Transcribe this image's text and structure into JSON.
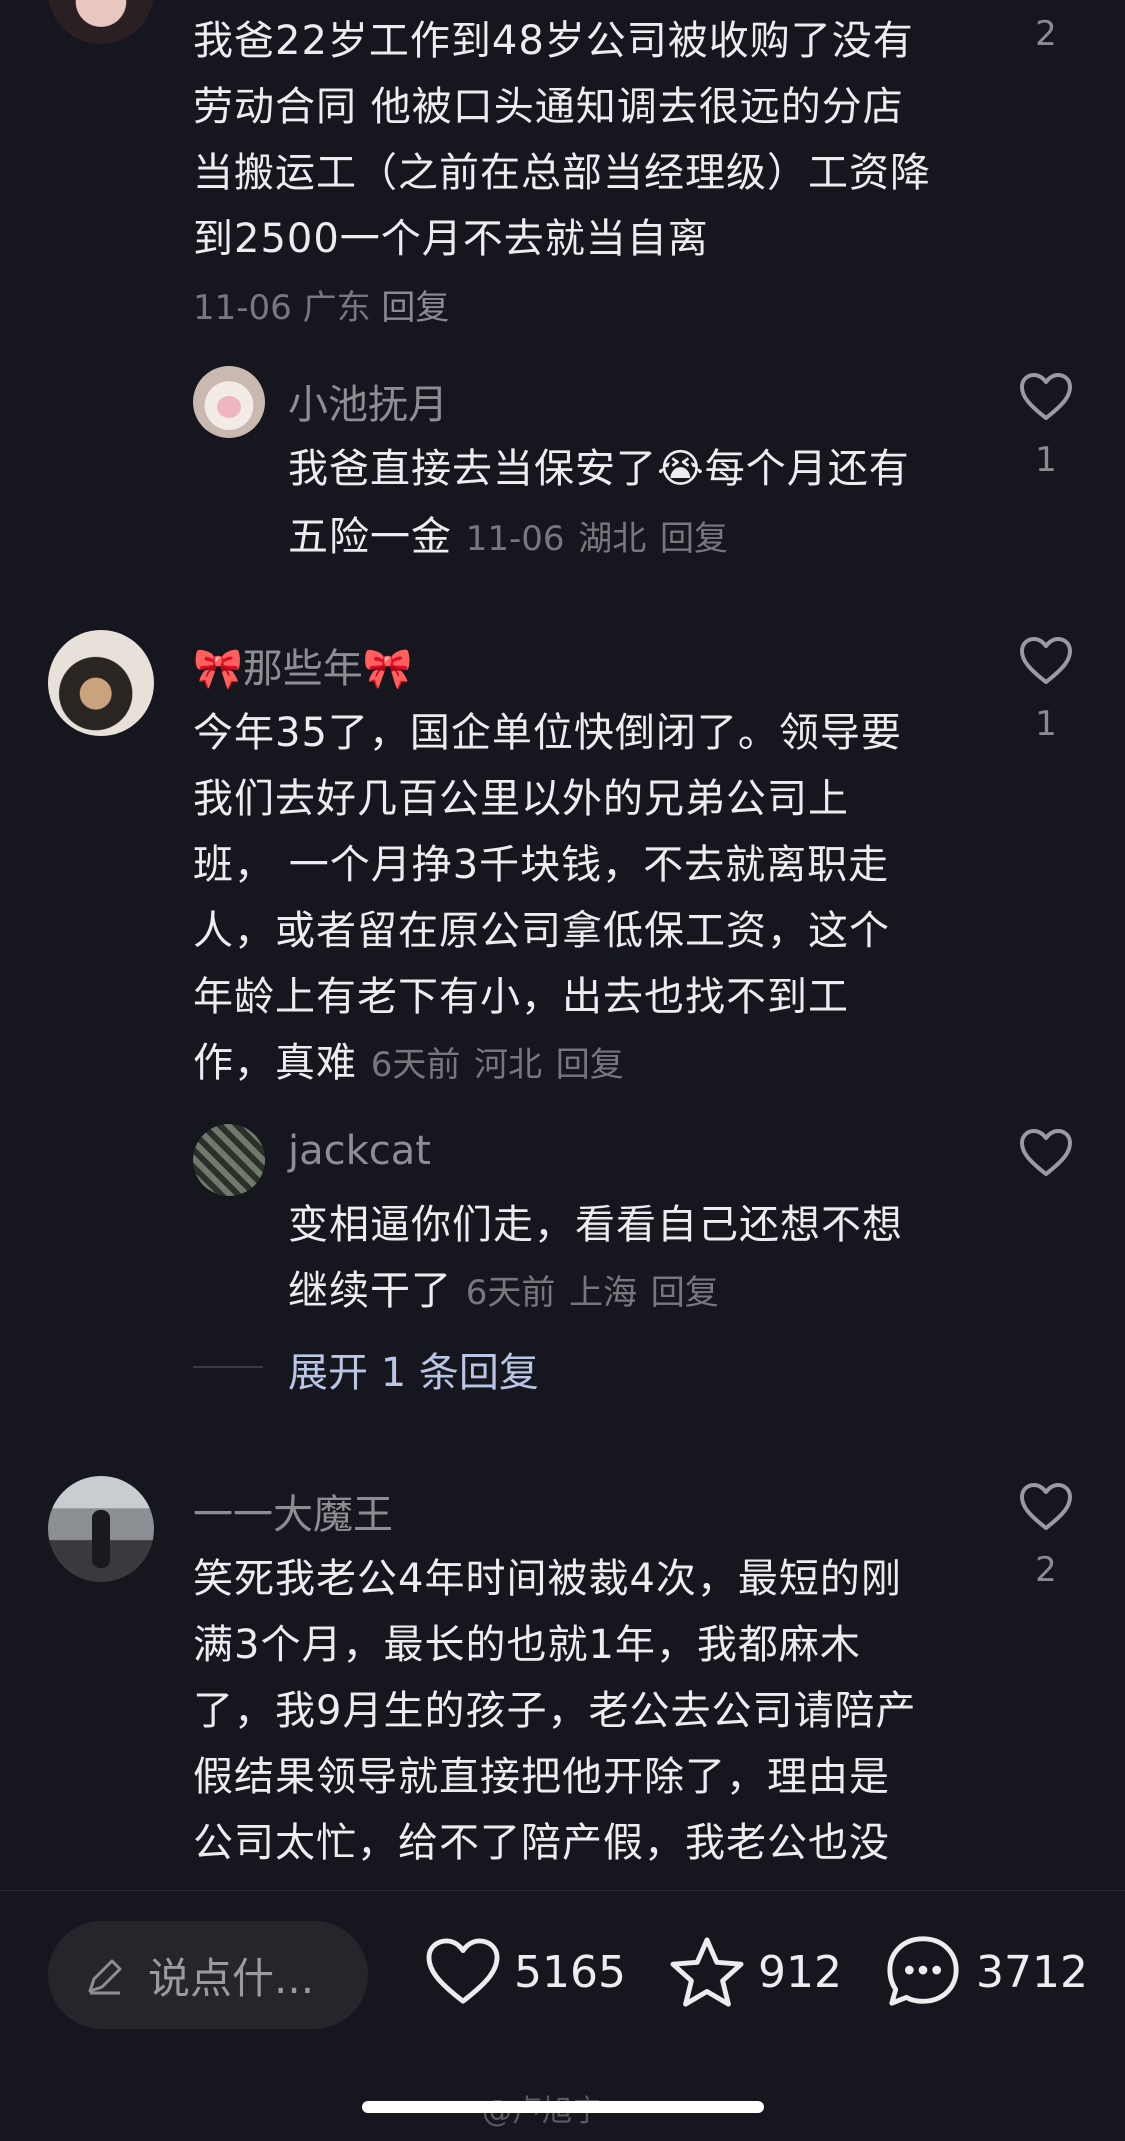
{
  "comments": [
    {
      "lines": [
        "我爸22岁工作到48岁公司被收购了没有",
        "劳动合同  他被口头通知调去很远的分店",
        "当搬运工（之前在总部当经理级）工资降",
        "到2500一个月不去就当自离"
      ],
      "meta_date": "11-06",
      "meta_location": "广东",
      "reply_label": "回复",
      "like_count": "2",
      "replies": [
        {
          "username": "小池抚月",
          "line1_a": "我爸直接去当保安了",
          "emoji": "😭",
          "line1_b": "每个月还有",
          "line2": "五险一金",
          "meta_date": "11-06",
          "meta_location": "湖北",
          "reply_label": "回复",
          "like_count": "1"
        }
      ]
    },
    {
      "username": "🎀那些年🎀",
      "lines": [
        "今年35了，国企单位快倒闭了。领导要",
        "我们去好几百公里以外的兄弟公司上",
        "班， 一个月挣3千块钱，不去就离职走",
        "人，或者留在原公司拿低保工资，这个",
        "年龄上有老下有小，出去也找不到工",
        "作，真难"
      ],
      "meta_date": "6天前",
      "meta_location": "河北",
      "reply_label": "回复",
      "like_count": "1",
      "replies": [
        {
          "username": "jackcat",
          "line1": "变相逼你们走，看看自己还想不想",
          "line2": "继续干了",
          "meta_date": "6天前",
          "meta_location": "上海",
          "reply_label": "回复"
        }
      ],
      "expand_label": "展开 1 条回复"
    },
    {
      "username": "一一大魔王",
      "lines": [
        "笑死我老公4年时间被裁4次，最短的刚",
        "满3个月，最长的也就1年，我都麻木",
        "了，我9月生的孩子，老公去公司请陪产",
        "假结果领导就直接把他开除了，理由是",
        "公司太忙，给不了陪产假，我老公也没"
      ],
      "like_count": "2"
    }
  ],
  "bottom_bar": {
    "input_placeholder": "说点什...",
    "likes": "5165",
    "favorites": "912",
    "comments": "3712"
  },
  "watermark": "@卢旭宁",
  "colors": {
    "background": "#16161e",
    "text": "#ededf0",
    "secondary": "#8d8d93",
    "link": "#b9c6e6"
  }
}
